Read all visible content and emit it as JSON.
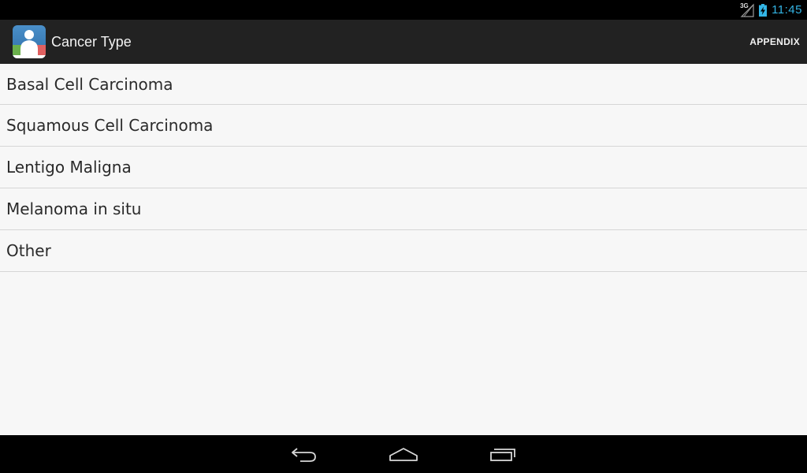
{
  "status_bar": {
    "network_label": "3G",
    "time": "11:45",
    "signal_icon": "signal-icon",
    "battery_icon": "battery-charging-icon",
    "time_color": "#33b5e5"
  },
  "action_bar": {
    "title": "Cancer Type",
    "action_label": "APPENDIX",
    "app_icon": "app-person-icon",
    "background": "#222222"
  },
  "list": {
    "items": [
      {
        "label": "Basal Cell Carcinoma"
      },
      {
        "label": "Squamous Cell Carcinoma"
      },
      {
        "label": "Lentigo Maligna"
      },
      {
        "label": "Melanoma in situ"
      },
      {
        "label": "Other"
      }
    ]
  },
  "nav_bar": {
    "back_icon": "back-icon",
    "home_icon": "home-icon",
    "recents_icon": "recents-icon"
  }
}
